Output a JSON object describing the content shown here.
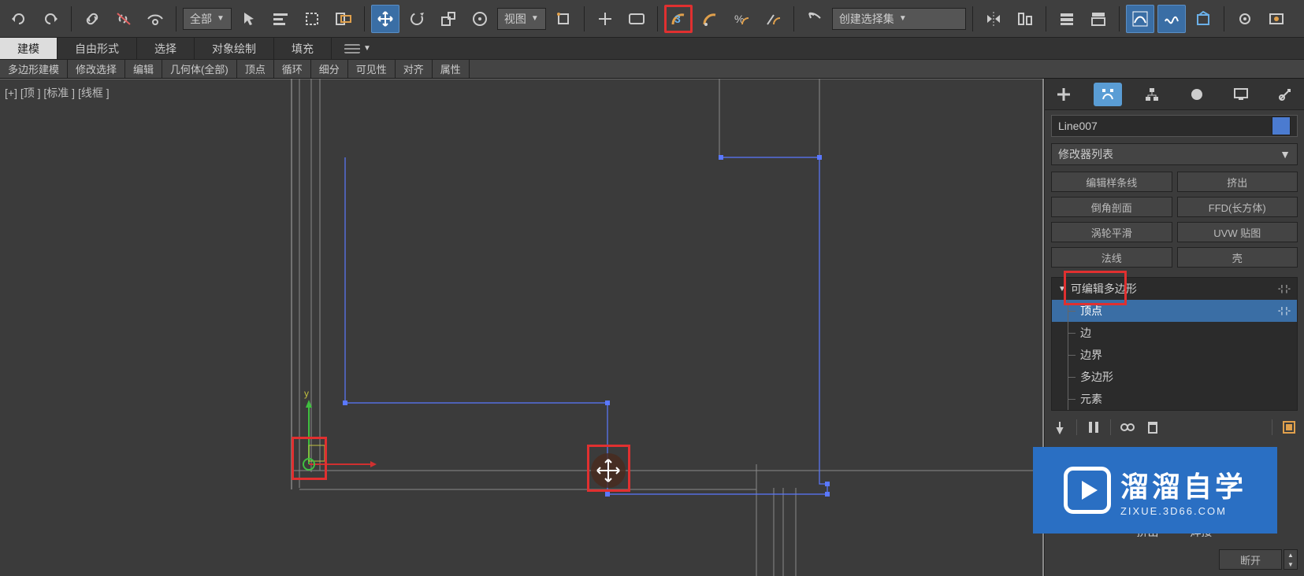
{
  "toolbar": {
    "dropdown1": "全部",
    "dropdown2": "视图",
    "angle_snap": "3",
    "selection_sets": "创建选择集"
  },
  "sub_tabs": [
    "建模",
    "自由形式",
    "选择",
    "对象绘制",
    "填充"
  ],
  "small_tabs": [
    "多边形建模",
    "修改选择",
    "编辑",
    "几何体(全部)",
    "顶点",
    "循环",
    "细分",
    "可见性",
    "对齐",
    "属性"
  ],
  "viewport_label": "[+] [顶 ] [标准 ] [线框 ]",
  "right": {
    "object_name": "Line007",
    "mod_list": "修改器列表",
    "mod_buttons": [
      [
        "编辑样条线",
        "挤出"
      ],
      [
        "倒角剖面",
        "FFD(长方体)"
      ],
      [
        "涡轮平滑",
        "UVW 贴图"
      ],
      [
        "法线",
        "壳"
      ]
    ],
    "stack_header": "可编辑多边形",
    "stack_items": [
      "顶点",
      "边",
      "边界",
      "多边形",
      "元素"
    ],
    "roll_left": "挤出",
    "roll_right": "焊接",
    "break_btn": "断开"
  },
  "watermark": {
    "big": "溜溜自学",
    "small": "ZIXUE.3D66.COM"
  }
}
